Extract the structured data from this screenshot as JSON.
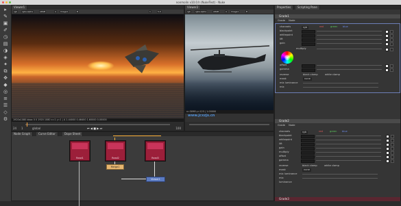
{
  "window": {
    "title": "nonmolin v10.0.h (NukeTest) - Nuke"
  },
  "watermark": "www.jcxzjs.cn",
  "tool_icons": [
    "select-tool-icon",
    "paint-icon",
    "image-icon",
    "draw-icon",
    "time-icon",
    "channel-icon",
    "color-icon",
    "filter-icon",
    "keyer-icon",
    "merge-icon",
    "transform-icon",
    "3d-icon",
    "views-icon",
    "metadata-icon",
    "toolsets-icon",
    "other-icon",
    "settings-icon"
  ],
  "viewer_left": {
    "tab": "Viewer1",
    "controls": [
      "rgb",
      "rgba.alpha",
      "sRGB",
      "A",
      "Image1",
      "B",
      "1",
      "5.0"
    ],
    "status": "1920x1080  bbox  0  0  1920  1080  x=1 y=1  |  A  1.44000   0.46400  1.60000  0.00000"
  },
  "viewer_right": {
    "tab": "Viewer2",
    "controls": [
      "rgb",
      "rgba.alpha",
      "sRGB",
      "A",
      "Image1",
      "B"
    ],
    "status": "x=3098 y=123  |  1.00000"
  },
  "timeline": {
    "fps": "24",
    "frame": "1",
    "range_end": "100",
    "mode": "global"
  },
  "nodegraph": {
    "tabs": [
      "Node Graph",
      "Curve Editor",
      "Dope Sheet"
    ],
    "nodes": [
      {
        "label": "Read1",
        "sub": "airplane.png"
      },
      {
        "label": "Read2",
        "sub": "sunset.png"
      },
      {
        "label": "Read3",
        "sub": "helicopter.png"
      }
    ],
    "merge_label": "Merge1",
    "viewer_label": "Viewer1"
  },
  "properties": {
    "tabs": [
      "Properties",
      "Scripting Pane"
    ],
    "node1": {
      "name": "Grade1",
      "tabs": [
        "Grade",
        "Node"
      ],
      "channels_label": "channels",
      "channels_value": "rgb",
      "channel_toggles": [
        "red",
        "green",
        "blue"
      ],
      "rows": [
        "blackpoint",
        "whitepoint",
        "lift",
        "gain",
        "multiply",
        "offset",
        "gamma"
      ],
      "extra_rows": [
        "reverse",
        "mix luminance",
        "mix",
        "luminance"
      ],
      "checks": [
        "black clamp",
        "white clamp"
      ],
      "mask_label": "mask",
      "mask_value": "none"
    },
    "node2": {
      "name": "Grade2",
      "tabs": [
        "Grade",
        "Node"
      ],
      "channels_label": "channels",
      "channels_value": "rgb",
      "channel_toggles": [
        "red",
        "green",
        "blue"
      ],
      "rows": [
        "blackpoint",
        "whitepoint",
        "lift",
        "gain",
        "multiply",
        "offset",
        "gamma"
      ],
      "extra_rows": [
        "reverse",
        "mix luminance",
        "mix",
        "luminance"
      ],
      "checks": [
        "black clamp",
        "white clamp"
      ],
      "mask_label": "mask",
      "mask_value": "none"
    },
    "node3": {
      "name": "Grade3"
    }
  }
}
